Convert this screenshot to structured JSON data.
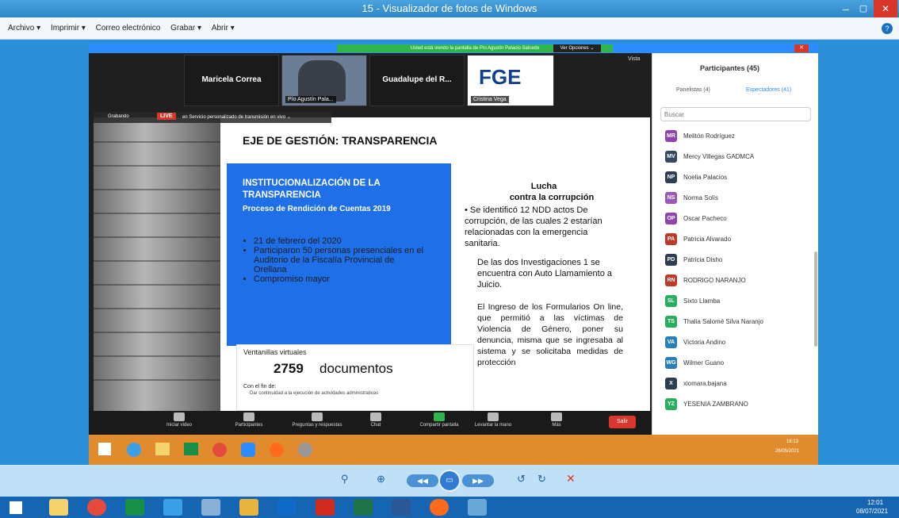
{
  "window": {
    "title": "15 - Visualizador de fotos de Windows"
  },
  "menu": [
    "Archivo ▾",
    "Imprimir ▾",
    "Correo electrónico",
    "Grabar ▾",
    "Abrir ▾"
  ],
  "zoom": {
    "share_banner": "Usted está viendo la pantalla de Pío Agustín Palacio Salcedo",
    "view_options": "Ver Opciones ⌄",
    "view_label": "Vista",
    "videos": [
      {
        "name": "Maricela Correa",
        "tag": ""
      },
      {
        "name": "",
        "tag": "Pío Agustín Pala..."
      },
      {
        "name": "Guadalupe del R...",
        "tag": ""
      },
      {
        "name": "FGE",
        "tag": "Cristina Vega"
      }
    ],
    "recording": "Grabando",
    "live": "LIVE",
    "live_desc": "en Servicio personalizado de transmisión en vivo ⌄"
  },
  "slide": {
    "title": "EJE DE GESTIÓN: TRANSPARENCIA",
    "box_title": "INSTITUCIONALIZACIÓN DE LA TRANSPARENCIA",
    "box_subtitle": "Proceso de Rendición de Cuentas 2019",
    "box_bullets": [
      "21 de febrero del 2020",
      "Participaron 50 personas presenciales en el Auditorio de la Fiscalía Provincial de Orellana",
      "Compromiso mayor"
    ],
    "vent_title": "Ventanillas virtuales",
    "vent_number": "2759",
    "vent_unit": "documentos",
    "vent_fin": "Con el fin de:",
    "vent_item": "Dar continuidad a la ejecución de actividades administrativas",
    "right_title": "Lucha",
    "right_subtitle": "contra la corrupción",
    "right_p1": "• Se identificó 12 NDD actos De corrupción, de las cuales 2 estarían relacionadas con la emergencia sanitaria.",
    "right_p2": "De las dos Investigaciones 1 se encuentra con Auto Llamamiento a Juicio.",
    "right_p3": "El Ingreso de los Formularios On line, que permitió a las víctimas de Violencia de Género, poner su denuncia, misma que se ingresaba al sistema y se solicitaba medidas de protección"
  },
  "controls": [
    {
      "label": "Iniciar video"
    },
    {
      "label": "Participantes",
      "count": "45"
    },
    {
      "label": "Preguntas y respuestas"
    },
    {
      "label": "Chat"
    },
    {
      "label": "Compartir pantalla"
    },
    {
      "label": "Levantar la mano"
    },
    {
      "label": "Más"
    }
  ],
  "leave": "Salir",
  "participants": {
    "title": "Participantes (45)",
    "tab_panelists": "Panelistas (4)",
    "tab_attendees": "Espectadores (41)",
    "search_placeholder": "Buscar",
    "list": [
      {
        "initials": "MR",
        "name": "Melitón Rodríguez",
        "color": "#8e44ad"
      },
      {
        "initials": "MV",
        "name": "Mercy Villegas GADMCA",
        "color": "#34495e"
      },
      {
        "initials": "NP",
        "name": "Noelia Palacios",
        "color": "#2c3e50"
      },
      {
        "initials": "NS",
        "name": "Norma Solís",
        "color": "#9b59b6"
      },
      {
        "initials": "OP",
        "name": "Oscar Pacheco",
        "color": "#8e44ad"
      },
      {
        "initials": "PA",
        "name": "Patricia Alvarado",
        "color": "#c0392b"
      },
      {
        "initials": "PD",
        "name": "Patricia Disho",
        "color": "#2c3e50"
      },
      {
        "initials": "RN",
        "name": "RODRIGO NARANJO",
        "color": "#c0392b"
      },
      {
        "initials": "SL",
        "name": "Sixto Llamba",
        "color": "#27ae60"
      },
      {
        "initials": "TS",
        "name": "Thalia Salomé Silva Naranjo",
        "color": "#27ae60"
      },
      {
        "initials": "VA",
        "name": "Victoria Andino",
        "color": "#2980b9"
      },
      {
        "initials": "WG",
        "name": "Wilmer Guano",
        "color": "#2980b9"
      },
      {
        "initials": "X",
        "name": "xiomara.bajana",
        "color": "#2c3e50"
      },
      {
        "initials": "YZ",
        "name": "YESENIA ZAMBRANO",
        "color": "#27ae60"
      }
    ]
  },
  "inner_clock": {
    "time": "16:13",
    "date": "26/05/2021"
  },
  "clock": {
    "time": "12:01",
    "date": "08/07/2021"
  }
}
